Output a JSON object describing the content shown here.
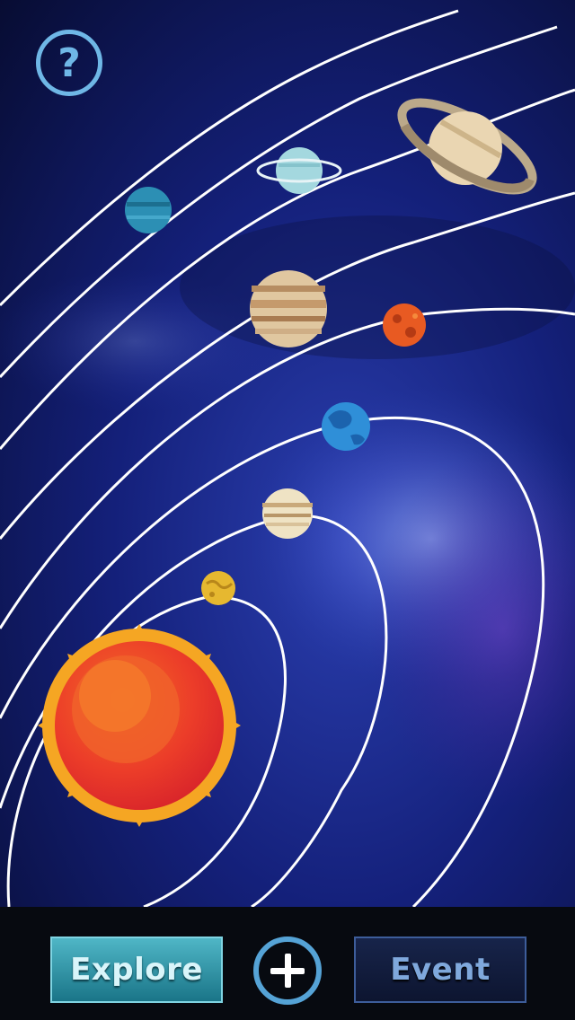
{
  "help_button": {
    "label": "?"
  },
  "bottom_bar": {
    "explore_label": "Explore",
    "event_label": "Event"
  },
  "planets": [
    "mercury",
    "venus",
    "earth",
    "mars",
    "jupiter",
    "saturn",
    "uranus",
    "neptune"
  ],
  "colors": {
    "space_dark": "#070b2a",
    "space_mid": "#1b2c86",
    "orbit_line": "#ffffff",
    "sun_core": "#e8302a",
    "sun_rays": "#f5a623",
    "accent_teal": "#2a97aa",
    "accent_navy": "#13214a"
  }
}
